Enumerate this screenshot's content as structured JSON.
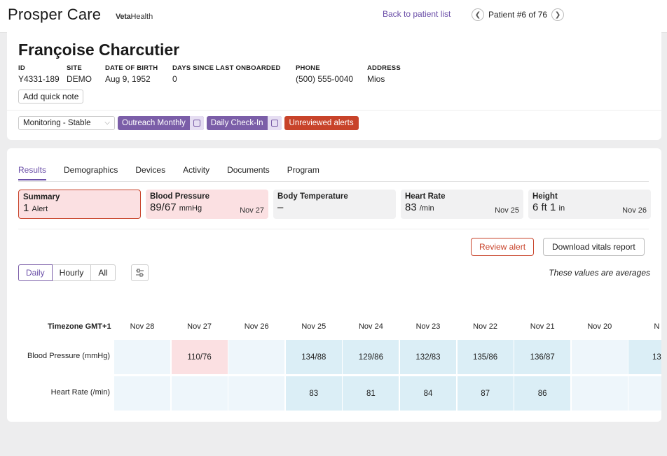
{
  "header": {
    "brand_main": "Prosper Care",
    "brand_sub_bold": "Veta",
    "brand_sub": "Health",
    "back_link": "Back to patient list",
    "pager_text": "Patient #6 of 76"
  },
  "patient": {
    "name": "Françoise Charcutier",
    "fields": [
      {
        "label": "ID",
        "value": "Y4331-189"
      },
      {
        "label": "SITE",
        "value": "DEMO"
      },
      {
        "label": "DATE OF BIRTH",
        "value": "Aug 9, 1952"
      },
      {
        "label": "DAYS SINCE LAST ONBOARDED",
        "value": "0"
      },
      {
        "label": "PHONE",
        "value": "(500) 555-0040"
      },
      {
        "label": "ADDRESS",
        "value": "Mios"
      }
    ],
    "quick_note": "Add quick note",
    "status_select": "Monitoring - Stable",
    "tags": {
      "outreach": "Outreach Monthly",
      "checkin": "Daily Check-In",
      "alerts": "Unreviewed alerts"
    }
  },
  "tabs": [
    "Results",
    "Demographics",
    "Devices",
    "Activity",
    "Documents",
    "Program"
  ],
  "vitals_cards": [
    {
      "title": "Summary",
      "value": "1",
      "unit": "Alert",
      "date": ""
    },
    {
      "title": "Blood Pressure",
      "value": "89/67",
      "unit": "mmHg",
      "date": "Nov 27"
    },
    {
      "title": "Body Temperature",
      "value": "–",
      "unit": "",
      "date": ""
    },
    {
      "title": "Heart Rate",
      "value": "83",
      "unit": "/min",
      "date": "Nov 25"
    },
    {
      "title": "Height",
      "value": "6 ft 1",
      "unit": "in",
      "date": "Nov 26"
    }
  ],
  "actions": {
    "review": "Review alert",
    "download": "Download vitals report"
  },
  "range": {
    "options": [
      "Daily",
      "Hourly",
      "All"
    ],
    "selected": "Daily",
    "note": "These values are averages"
  },
  "table": {
    "timezone": "Timezone GMT+1",
    "dates": [
      "Nov 28",
      "Nov 27",
      "Nov 26",
      "Nov 25",
      "Nov 24",
      "Nov 23",
      "Nov 22",
      "Nov 21",
      "Nov 20",
      "N"
    ],
    "rows": [
      {
        "label": "Blood Pressure (mmHg)",
        "values": [
          "",
          "110/76",
          "",
          "134/88",
          "129/86",
          "132/83",
          "135/86",
          "136/87",
          "",
          "13"
        ]
      },
      {
        "label": "Heart Rate (/min)",
        "values": [
          "",
          "",
          "",
          "83",
          "81",
          "84",
          "87",
          "86",
          "",
          ""
        ]
      }
    ],
    "alert_cell": {
      "row": 0,
      "col": 1
    }
  },
  "colors": {
    "brand_purple": "#7b5ea8",
    "alert_red": "#c8432a",
    "alert_pink": "#fbe0e2",
    "cell_blue": "#dbeef6"
  }
}
